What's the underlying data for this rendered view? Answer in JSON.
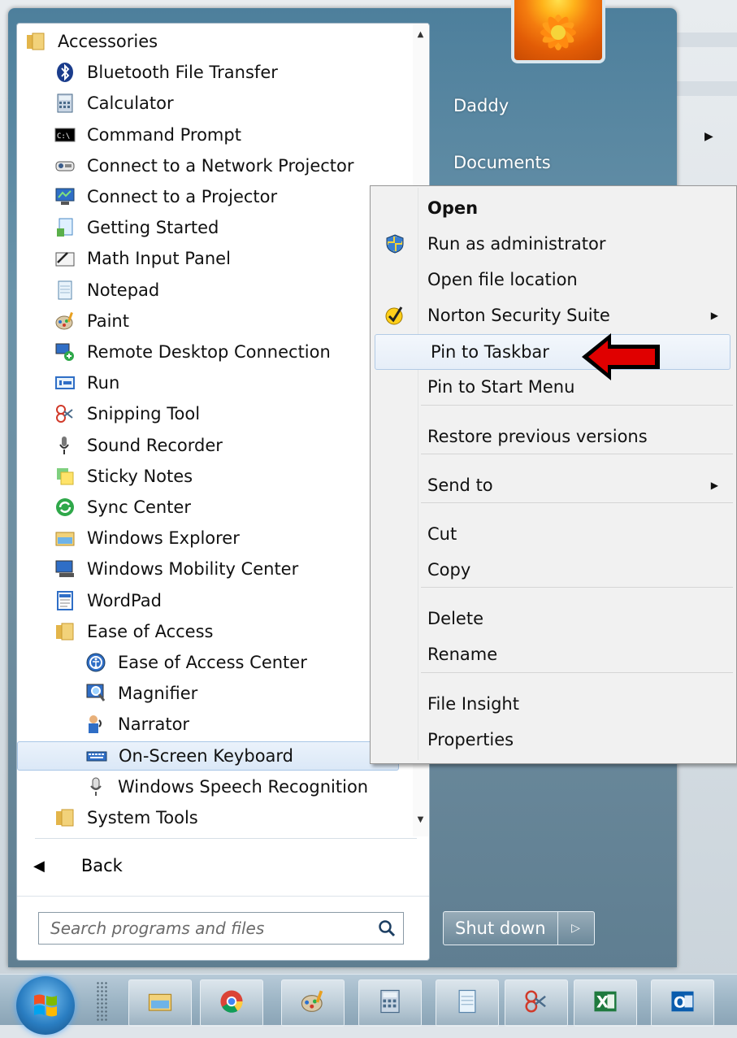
{
  "programs": {
    "items": [
      {
        "label": "Accessories",
        "icon": "folder-icon",
        "level": 0
      },
      {
        "label": "Bluetooth File Transfer",
        "icon": "bluetooth-icon",
        "level": 1
      },
      {
        "label": "Calculator",
        "icon": "calculator-icon",
        "level": 1
      },
      {
        "label": "Command Prompt",
        "icon": "command-prompt-icon",
        "level": 1
      },
      {
        "label": "Connect to a Network Projector",
        "icon": "network-projector-icon",
        "level": 1
      },
      {
        "label": "Connect to a Projector",
        "icon": "projector-icon",
        "level": 1
      },
      {
        "label": "Getting Started",
        "icon": "getting-started-icon",
        "level": 1
      },
      {
        "label": "Math Input Panel",
        "icon": "math-input-icon",
        "level": 1
      },
      {
        "label": "Notepad",
        "icon": "notepad-icon",
        "level": 1
      },
      {
        "label": "Paint",
        "icon": "paint-icon",
        "level": 1
      },
      {
        "label": "Remote Desktop Connection",
        "icon": "remote-desktop-icon",
        "level": 1
      },
      {
        "label": "Run",
        "icon": "run-icon",
        "level": 1
      },
      {
        "label": "Snipping Tool",
        "icon": "snipping-tool-icon",
        "level": 1
      },
      {
        "label": "Sound Recorder",
        "icon": "microphone-icon",
        "level": 1
      },
      {
        "label": "Sticky Notes",
        "icon": "sticky-notes-icon",
        "level": 1
      },
      {
        "label": "Sync Center",
        "icon": "sync-center-icon",
        "level": 1
      },
      {
        "label": "Windows Explorer",
        "icon": "windows-explorer-icon",
        "level": 1
      },
      {
        "label": "Windows Mobility Center",
        "icon": "mobility-center-icon",
        "level": 1
      },
      {
        "label": "WordPad",
        "icon": "wordpad-icon",
        "level": 1
      },
      {
        "label": "Ease of Access",
        "icon": "folder-icon",
        "level": 1
      },
      {
        "label": "Ease of Access Center",
        "icon": "ease-of-access-icon",
        "level": 2
      },
      {
        "label": "Magnifier",
        "icon": "magnifier-icon",
        "level": 2
      },
      {
        "label": "Narrator",
        "icon": "narrator-icon",
        "level": 2
      },
      {
        "label": "On-Screen Keyboard",
        "icon": "keyboard-icon",
        "level": 2,
        "selected": true
      },
      {
        "label": "Windows Speech Recognition",
        "icon": "speech-recognition-icon",
        "level": 2
      },
      {
        "label": "System Tools",
        "icon": "folder-icon",
        "level": 1
      }
    ],
    "back_label": "Back"
  },
  "search": {
    "placeholder": "Search programs and files"
  },
  "right_pane": {
    "user_name": "Daddy",
    "documents_label": "Documents"
  },
  "shutdown": {
    "label": "Shut down"
  },
  "context_menu": {
    "items": [
      {
        "label": "Open",
        "bold": true
      },
      {
        "label": "Run as administrator",
        "icon": "uac-shield-icon"
      },
      {
        "label": "Open file location"
      },
      {
        "label": "Norton Security Suite",
        "icon": "norton-check-icon",
        "submenu": true
      },
      {
        "label": "Pin to Taskbar",
        "hover": true
      },
      {
        "label": "Pin to Start Menu"
      },
      {
        "label": "Restore previous versions"
      },
      {
        "label": "Send to",
        "submenu": true
      },
      {
        "label": "Cut"
      },
      {
        "label": "Copy"
      },
      {
        "label": "Delete"
      },
      {
        "label": "Rename"
      },
      {
        "label": "File Insight"
      },
      {
        "label": "Properties"
      }
    ]
  },
  "taskbar": {
    "buttons": [
      "windows-explorer-icon",
      "chrome-icon",
      "paint-icon",
      "calculator-icon",
      "notepad-icon",
      "snipping-tool-icon",
      "excel-icon",
      "outlook-icon"
    ],
    "excel_glyph": "X",
    "outlook_glyph": "O"
  },
  "colors": {
    "accent_red": "#e00000",
    "menu_blue": "#4d7f9c"
  }
}
